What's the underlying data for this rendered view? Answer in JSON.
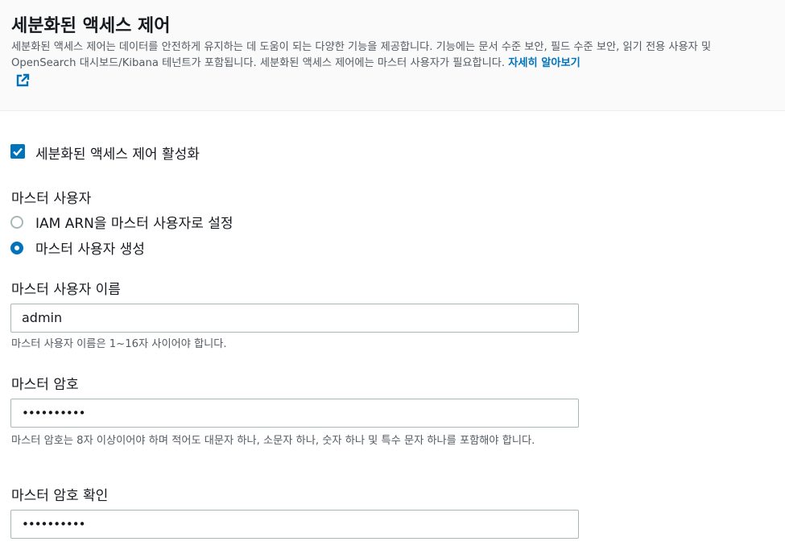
{
  "header": {
    "title": "세분화된 액세스 제어",
    "description": "세분화된 액세스 제어는 데이터를 안전하게 유지하는 데 도움이 되는 다양한 기능을 제공합니다. 기능에는 문서 수준 보안, 필드 수준 보안, 읽기 전용 사용자 및 OpenSearch 대시보드/Kibana 테넌트가 포함됩니다. 세분화된 액세스 제어에는 마스터 사용자가 필요합니다.",
    "learn_more": "자세히 알아보기",
    "external_icon": "external-link-icon"
  },
  "fgac": {
    "enable_label": "세분화된 액세스 제어 활성화",
    "enabled": true
  },
  "master_user": {
    "section_label": "마스터 사용자",
    "options": [
      {
        "label": "IAM ARN을 마스터 사용자로 설정",
        "selected": false
      },
      {
        "label": "마스터 사용자 생성",
        "selected": true
      }
    ]
  },
  "username": {
    "label": "마스터 사용자 이름",
    "value": "admin",
    "hint": "마스터 사용자 이름은 1~16자 사이어야 합니다."
  },
  "password": {
    "label": "마스터 암호",
    "value": "••••••••••",
    "hint": "마스터 암호는 8자 이상이어야 하며 적어도 대문자 하나, 소문자 하나, 숫자 하나 및 특수 문자 하나를 포함해야 합니다."
  },
  "confirm_password": {
    "label": "마스터 암호 확인",
    "value": "••••••••••"
  },
  "colors": {
    "accent": "#0073bb",
    "text": "#16191f",
    "secondary_text": "#545b64",
    "border": "#aab7b8"
  }
}
